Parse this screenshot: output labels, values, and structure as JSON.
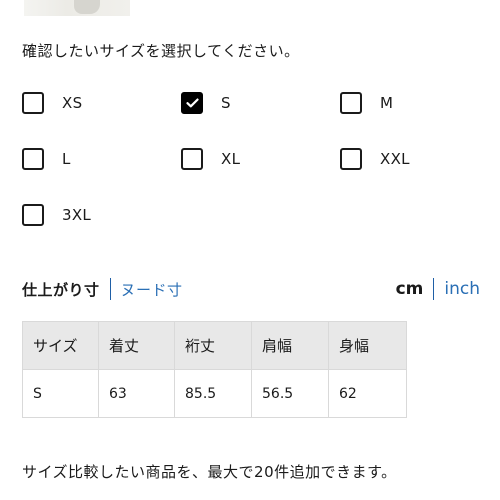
{
  "size_picker": {
    "instruction": "確認したいサイズを選択してください。",
    "options": [
      {
        "label": "XS",
        "checked": false
      },
      {
        "label": "S",
        "checked": true
      },
      {
        "label": "M",
        "checked": false
      },
      {
        "label": "L",
        "checked": false
      },
      {
        "label": "XL",
        "checked": false
      },
      {
        "label": "XXL",
        "checked": false
      },
      {
        "label": "3XL",
        "checked": false
      }
    ]
  },
  "measure_tabs": {
    "finished": "仕上がり寸",
    "nude": "ヌード寸"
  },
  "units": {
    "cm": "cm",
    "inch": "inch"
  },
  "size_table": {
    "headers": [
      "サイズ",
      "着丈",
      "裄丈",
      "肩幅",
      "身幅"
    ],
    "rows": [
      [
        "S",
        "63",
        "85.5",
        "56.5",
        "62"
      ]
    ]
  },
  "compare_note": "サイズ比較したい商品を、最大で20件追加できます。",
  "colors": {
    "text": "#1b1b1b",
    "link_blue": "#2a6fb5",
    "checkbox_checked": "#000000",
    "table_header_bg": "#e8e8e8",
    "table_border": "#d9d9d9"
  }
}
